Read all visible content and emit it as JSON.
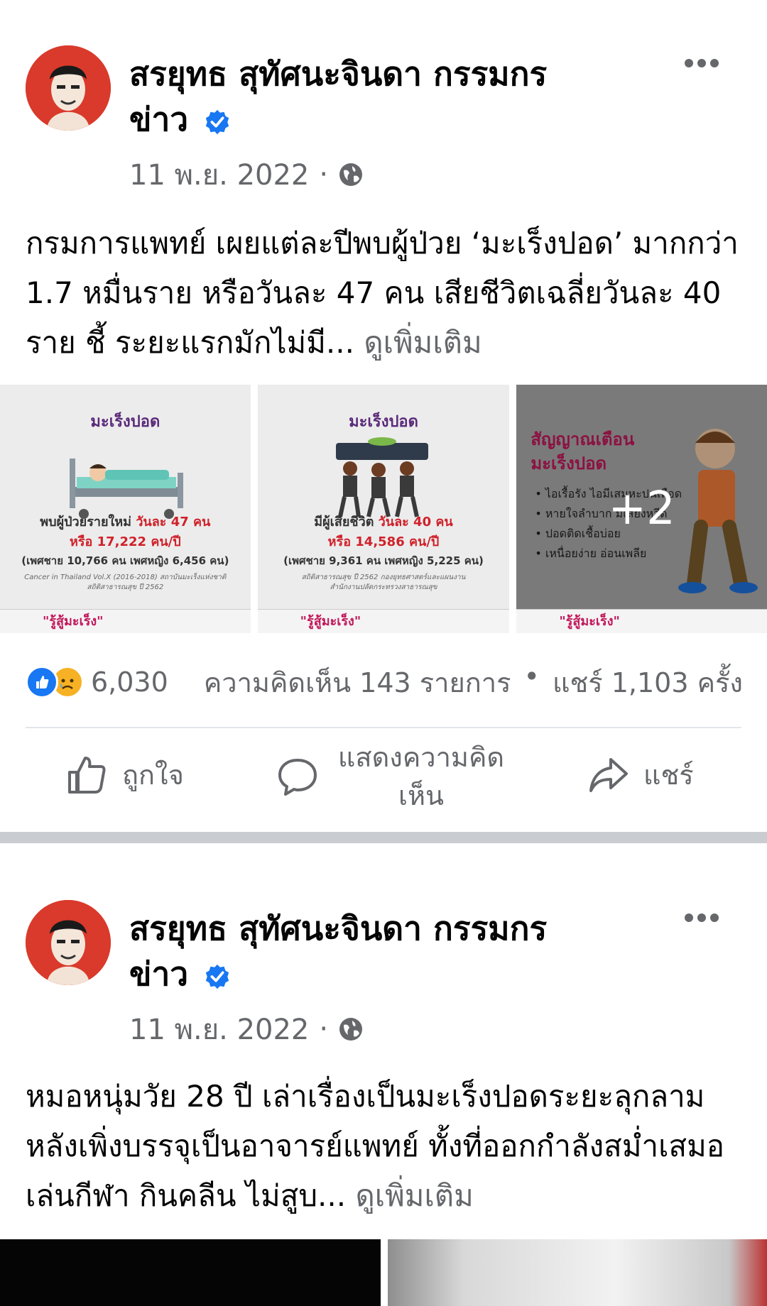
{
  "posts": [
    {
      "author_line1": "สรยุทธ สุทัศนะจินดา กรรมกร",
      "author_line2": "ข่าว",
      "date": "11 พ.ย. 2022",
      "separator": "·",
      "text": "กรมการแพทย์ เผยแต่ละปีพบผู้ป่วย ‘มะเร็งปอด’ มากกว่า 1.7 หมื่นราย หรือวันละ 47 คน เสียชีวิตเฉลี่ยวันละ 40 ราย ชี้ ระยะแรกมักไม่มี...",
      "see_more": "ดูเพิ่มเติม",
      "images": {
        "tile1": {
          "title": "มะเร็งปอด",
          "line1_prefix": "พบผู้ป่วยรายใหม่",
          "line1_highlight": "วันละ 47 คน",
          "line2": "หรือ 17,222 คน/ปี",
          "line3": "(เพศชาย 10,766 คน เพศหญิง 6,456 คน)",
          "source1": "Cancer in Thailand Vol.X (2016-2018) สถาบันมะเร็งแห่งชาติ",
          "source2": "สถิติสาธารณสุข ปี 2562",
          "footer": "\"รู้สู้มะเร็ง\""
        },
        "tile2": {
          "title": "มะเร็งปอด",
          "line1_prefix": "มีผู้เสียชีวิต",
          "line1_highlight": "วันละ 40 คน",
          "line2": "หรือ 14,586 คน/ปี",
          "line3": "(เพศชาย 9,361 คน เพศหญิง 5,225 คน)",
          "source1": "สถิติสาธารณสุข ปี 2562 กองยุทธศาสตร์และแผนงาน",
          "source2": "สำนักงานปลัดกระทรวงสาธารณสุข",
          "footer": "\"รู้สู้มะเร็ง\""
        },
        "tile3": {
          "title_line1": "สัญญาณเตือน",
          "title_line2": "มะเร็งปอด",
          "bullets": [
            "ไอเรื้อรัง ไอมีเสมหะปนเลือด",
            "หายใจลำบาก มีเสียงหวีด",
            "ปอดติดเชื้อบ่อย",
            "เหนื่อยง่าย อ่อนเพลีย"
          ],
          "more_count": "+2",
          "footer": "\"รู้สู้มะเร็ง\""
        }
      },
      "reactions_count": "6,030",
      "comments": "ความคิดเห็น 143 รายการ",
      "dot": "•",
      "shares": "แชร์ 1,103 ครั้ง"
    },
    {
      "author_line1": "สรยุทธ สุทัศนะจินดา กรรมกร",
      "author_line2": "ข่าว",
      "date": "11 พ.ย. 2022",
      "separator": "·",
      "text": "หมอหนุ่มวัย 28 ปี เล่าเรื่องเป็นมะเร็งปอดระยะลุกลาม หลังเพิ่งบรรจุเป็นอาจารย์แพทย์ ทั้งที่ออกกำลังสม่ำเสมอ เล่นกีฬา กินคลีน ไม่สูบ...",
      "see_more": "ดูเพิ่มเติม"
    }
  ],
  "actions": {
    "like": "ถูกใจ",
    "comment": "แสดงความคิดเห็น",
    "share": "แชร์"
  },
  "colors": {
    "brand_blue": "#1877f2",
    "secondary_text": "#65676b",
    "divider": "#c9ccd1"
  },
  "icons": [
    "more-options-icon",
    "verified-badge-icon",
    "globe-icon",
    "like-reaction-icon",
    "sad-reaction-icon",
    "thumbs-up-icon",
    "comment-bubble-icon",
    "share-arrow-icon"
  ]
}
